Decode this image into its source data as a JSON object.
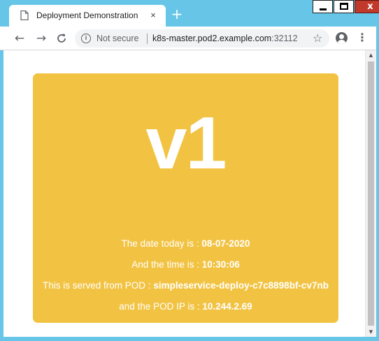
{
  "tab": {
    "title": "Deployment Demonstration",
    "close_glyph": "×",
    "new_tab_glyph": "+"
  },
  "window": {
    "close_glyph": "x"
  },
  "toolbar": {
    "back_glyph": "←",
    "forward_glyph": "→",
    "reload_glyph": "C",
    "security_label": "Not secure",
    "url_host": "k8s-master.pod2.example.com",
    "url_port": ":32112",
    "star_glyph": "☆",
    "menu_glyph": "⋮"
  },
  "page": {
    "version": "v1",
    "date_label": "The date today is : ",
    "date_value": "08-07-2020",
    "time_label": "And the time is : ",
    "time_value": "10:30:06",
    "pod_label": "This is served from POD : ",
    "pod_value": "simpleservice-deploy-c7c8898bf-cv7nb",
    "ip_label": "and the POD IP is : ",
    "ip_value": "10.244.2.69"
  },
  "colors": {
    "frame": "#67c6e8",
    "card": "#f2c343",
    "card_text": "#ffffff"
  },
  "icons": [
    "page-icon",
    "close-icon",
    "plus-icon",
    "minimize-icon",
    "maximize-icon",
    "back-icon",
    "forward-icon",
    "reload-icon",
    "info-icon",
    "star-icon",
    "account-icon",
    "menu-icon"
  ]
}
